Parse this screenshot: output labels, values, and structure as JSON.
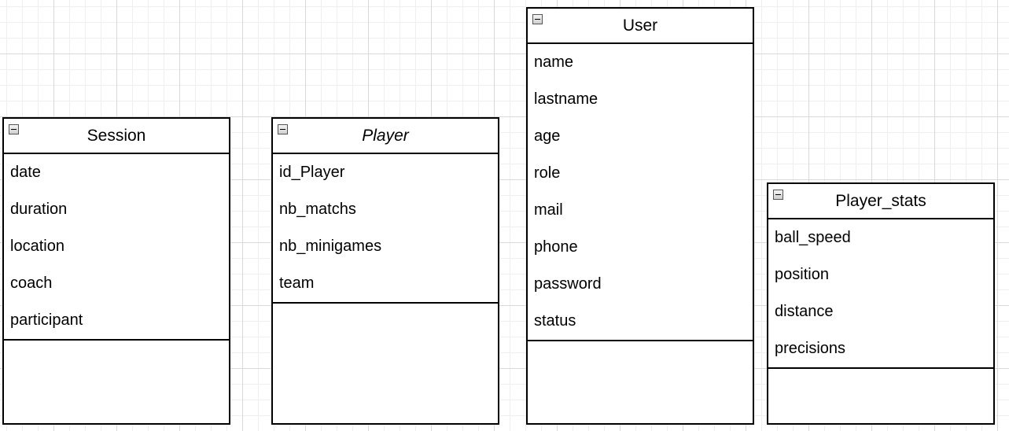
{
  "classes": {
    "session": {
      "name": "Session",
      "attributes": [
        "date",
        "duration",
        "location",
        "coach",
        "participant"
      ]
    },
    "player": {
      "name": "Player",
      "attributes": [
        "id_Player",
        "nb_matchs",
        "nb_minigames",
        "team"
      ]
    },
    "user": {
      "name": "User",
      "attributes": [
        "name",
        "lastname",
        "age",
        "role",
        "mail",
        "phone",
        "password",
        "status"
      ]
    },
    "player_stats": {
      "name": "Player_stats",
      "attributes": [
        "ball_speed",
        "position",
        "distance",
        "precisions"
      ]
    }
  },
  "icons": {
    "collapse": "collapse-minus-icon"
  }
}
